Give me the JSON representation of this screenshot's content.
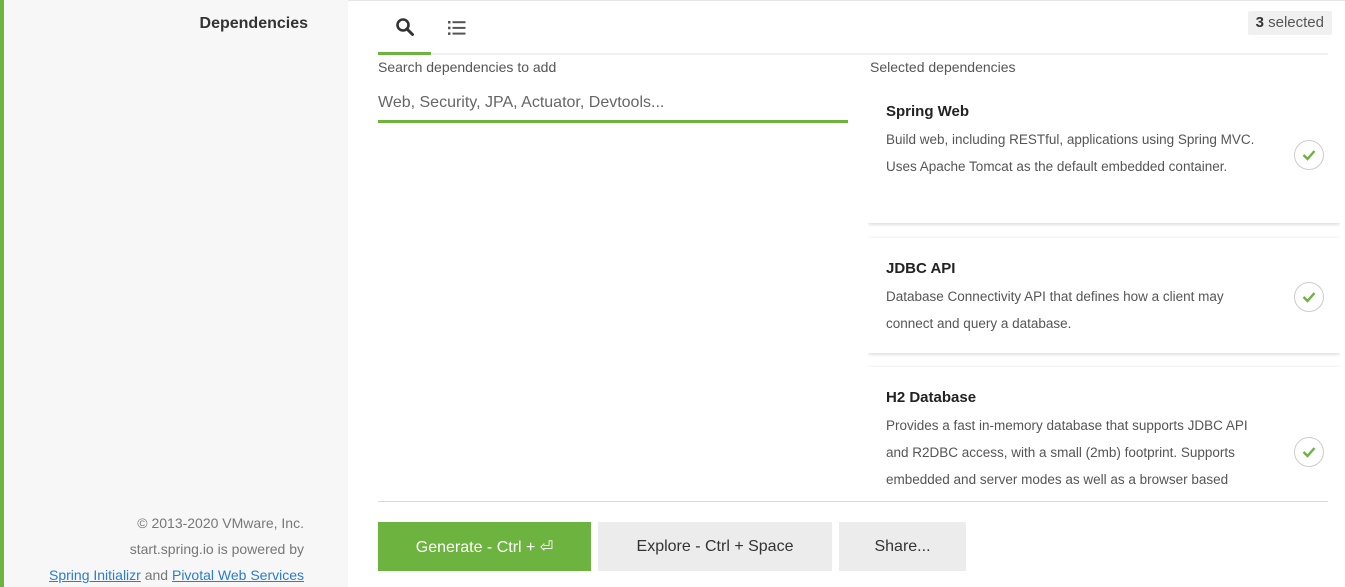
{
  "sidebar": {
    "title": "Dependencies",
    "footer": {
      "copyright": "© 2013-2020 VMware, Inc.",
      "powered_by": "start.spring.io is powered by",
      "link1": "Spring Initializr",
      "and": "and",
      "link2": "Pivotal Web Services"
    }
  },
  "header": {
    "tabs": [
      {
        "icon": "search-icon",
        "active": true
      },
      {
        "icon": "list-icon",
        "active": false
      }
    ],
    "selected_count": "3",
    "selected_suffix": "selected"
  },
  "search": {
    "label": "Search dependencies to add",
    "placeholder": "Web, Security, JPA, Actuator, Devtools...",
    "value": ""
  },
  "selected": {
    "label": "Selected dependencies",
    "items": [
      {
        "name": "Spring Web",
        "description": "Build web, including RESTful, applications using Spring MVC. Uses Apache Tomcat as the default embedded container."
      },
      {
        "name": "JDBC API",
        "description": "Database Connectivity API that defines how a client may connect and query a database."
      },
      {
        "name": "H2 Database",
        "description": "Provides a fast in-memory database that supports JDBC API and R2DBC access, with a small (2mb) footprint. Supports embedded and server modes as well as a browser based console application."
      }
    ]
  },
  "actions": {
    "generate": "Generate - Ctrl + ⏎",
    "explore": "Explore - Ctrl + Space",
    "share": "Share..."
  },
  "colors": {
    "accent": "#6db33f"
  }
}
